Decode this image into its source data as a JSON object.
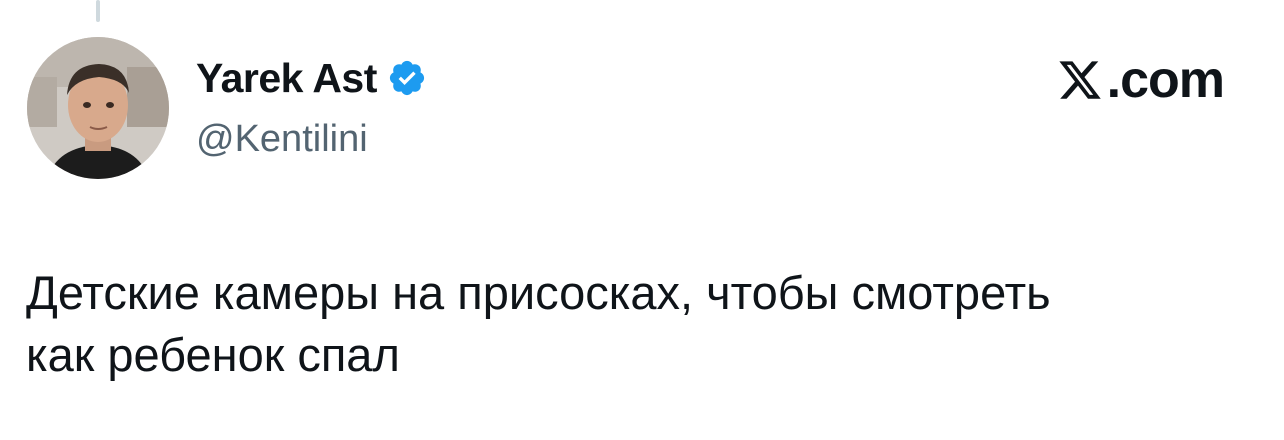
{
  "author": {
    "display_name": "Yarek Ast",
    "handle": "@Kentilini",
    "verified": true,
    "avatar_icon": "user-avatar-photo"
  },
  "brand": {
    "label": ".com",
    "icon": "x-logo-icon"
  },
  "tweet": {
    "text": "Детские камеры на присосках, чтобы смотреть\nкак ребенок спал"
  },
  "colors": {
    "text_primary": "#0f1419",
    "text_secondary": "#536471",
    "verified_blue": "#1d9bf0",
    "thread_line": "#cfd9de"
  }
}
